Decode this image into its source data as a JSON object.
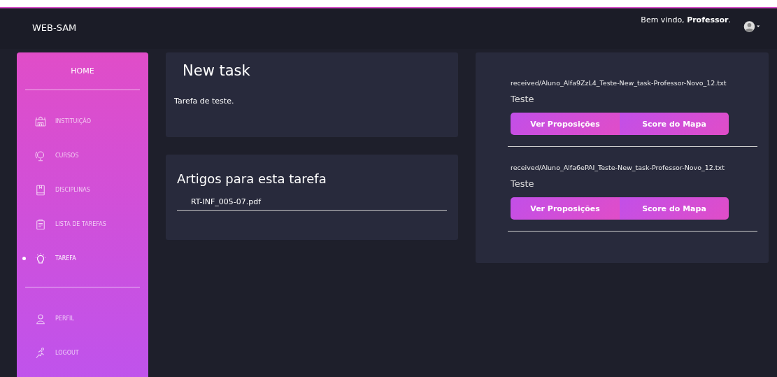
{
  "navbar": {
    "brand": "WEB-SAM",
    "greeting": "Bem vindo, **Professor**."
  },
  "sidebar": {
    "home": "HOME",
    "items": [
      {
        "label": "INSTITUIÇÃO",
        "kind": "building",
        "selected": false
      },
      {
        "label": "CURSOS",
        "kind": "globe",
        "selected": false
      },
      {
        "label": "DISCIPLINAS",
        "kind": "book",
        "selected": false
      },
      {
        "label": "LISTA DE TAREFAS",
        "kind": "clipboard",
        "selected": false
      },
      {
        "label": "TAREFA",
        "kind": "bulb",
        "selected": true
      }
    ],
    "bottom_items": [
      {
        "label": "PERFIL",
        "kind": "person",
        "selected": false
      },
      {
        "label": "LOGOUT",
        "kind": "runner",
        "selected": false
      }
    ]
  },
  "task": {
    "title": "New task",
    "description": "Tarefa de teste."
  },
  "articles": {
    "title": "Artigos para esta tarefa",
    "files": [
      "RT-INF_005-07.pdf"
    ]
  },
  "submissions": [
    {
      "file": "received/Aluno_Alfa9ZzL4_Teste-New_task-Professor-Novo_12.txt",
      "name": "Teste",
      "buttons": [
        "Ver Proposições",
        "Score do Mapa"
      ]
    },
    {
      "file": "received/Aluno_Alfa6ePAI_Teste-New_task-Professor-Novo_12.txt",
      "name": "Teste",
      "buttons": [
        "Ver Proposições",
        "Score do Mapa"
      ]
    }
  ]
}
